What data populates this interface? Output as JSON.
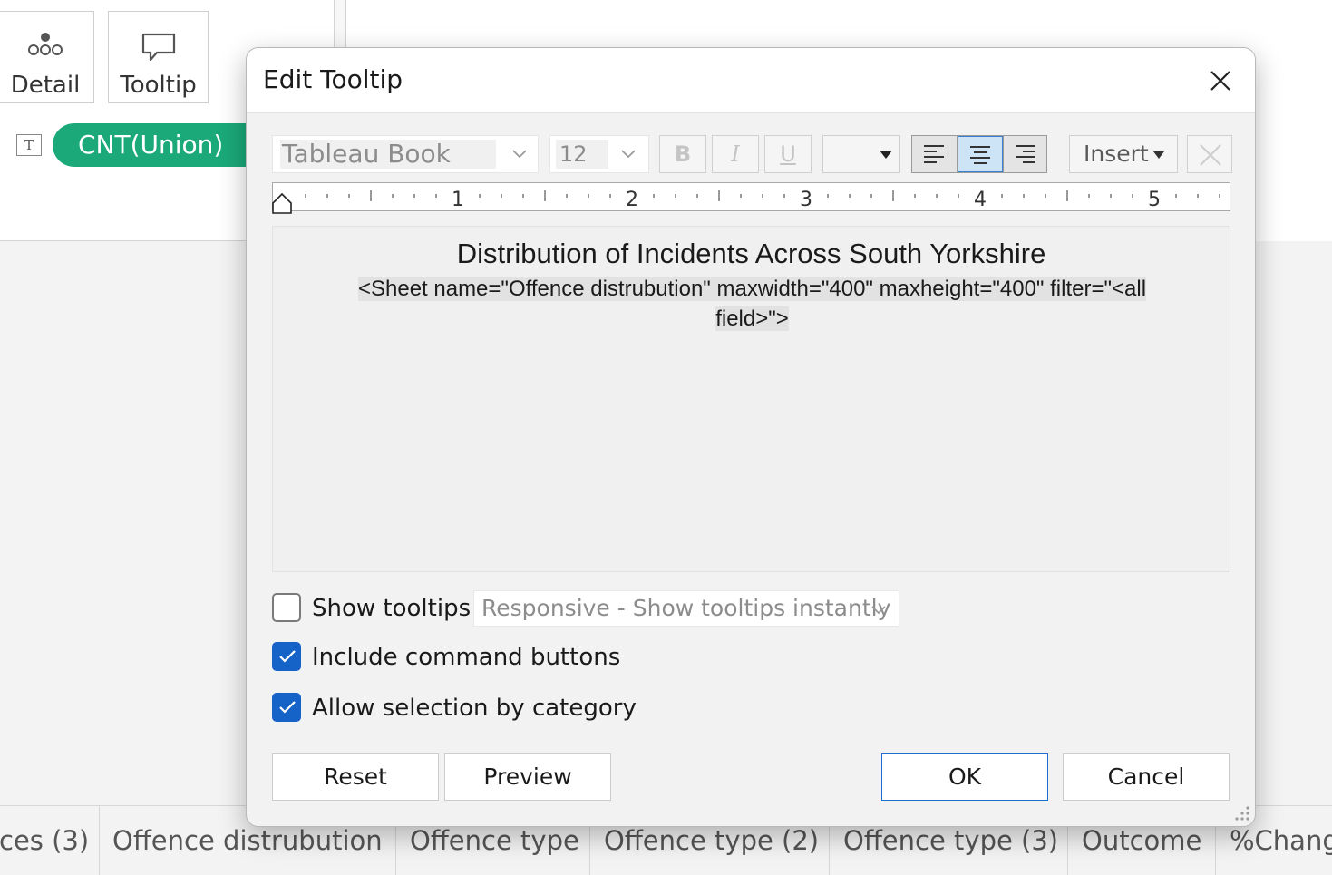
{
  "marks": {
    "detail_label": "Detail",
    "tooltip_label": "Tooltip",
    "pill_type_glyph": "T",
    "pill_label": "CNT(Union)",
    "pill_color": "#1ba97a"
  },
  "sheet_tabs": [
    "ces (3)",
    "Offence distrubution",
    "Offence type",
    "Offence type (2)",
    "Offence type (3)",
    "Outcome",
    "%Chang"
  ],
  "dialog": {
    "title": "Edit Tooltip",
    "toolbar": {
      "font": "Tableau Book",
      "size": "12",
      "bold": "B",
      "italic": "I",
      "underline": "U",
      "insert": "Insert",
      "alignment_selected": "center"
    },
    "ruler_labels": [
      "1",
      "2",
      "3",
      "4",
      "5"
    ],
    "editor": {
      "title": "Distribution of Incidents Across South Yorkshire",
      "sheet_line_1": "<Sheet name=\"Offence distrubution\" maxwidth=\"400\" maxheight=\"400\" filter=\"<all",
      "sheet_line_2": "field>\">"
    },
    "options": {
      "show_tooltips": {
        "label": "Show tooltips",
        "checked": false
      },
      "tooltip_mode": "Responsive - Show tooltips instantly",
      "include_command_buttons": {
        "label": "Include command buttons",
        "checked": true
      },
      "allow_selection": {
        "label": "Allow selection by category",
        "checked": true
      }
    },
    "buttons": {
      "reset": "Reset",
      "preview": "Preview",
      "ok": "OK",
      "cancel": "Cancel"
    },
    "accent_color": "#1663c7"
  }
}
